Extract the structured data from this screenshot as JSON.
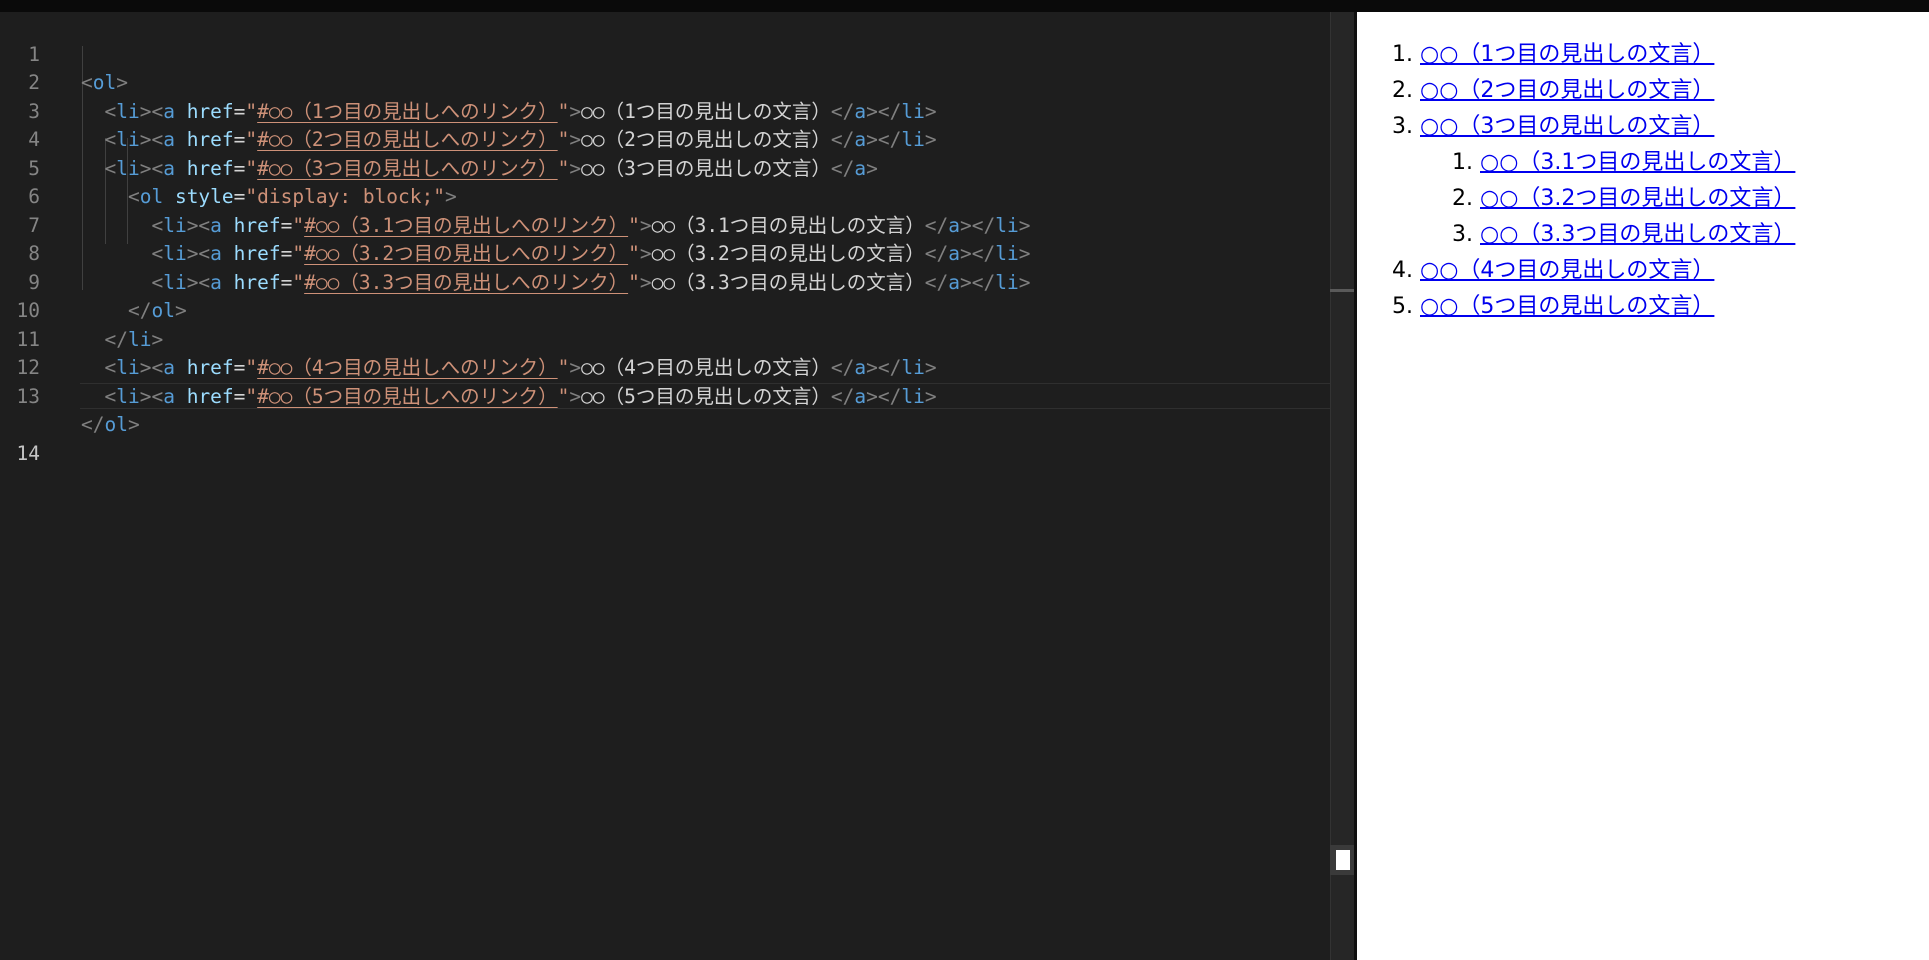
{
  "editor": {
    "lines": [
      {
        "num": "1",
        "open": "<ol>"
      },
      {
        "num": "2",
        "href": "#○○（1つ目の見出しへのリンク）",
        "text": "○○（1つ目の見出しの文言）"
      },
      {
        "num": "3",
        "href": "#○○（2つ目の見出しへのリンク）",
        "text": "○○（2つ目の見出しの文言）"
      },
      {
        "num": "4",
        "href": "#○○（3つ目の見出しへのリンク）",
        "text": "○○（3つ目の見出しの文言）"
      },
      {
        "num": "5",
        "style_value": "display: block;"
      },
      {
        "num": "6",
        "href": "#○○（3.1つ目の見出しへのリンク）",
        "text": "○○（3.1つ目の見出しの文言）"
      },
      {
        "num": "7",
        "href": "#○○（3.2つ目の見出しへのリンク）",
        "text": "○○（3.2つ目の見出しの文言）"
      },
      {
        "num": "8",
        "href": "#○○（3.3つ目の見出しへのリンク）",
        "text": "○○（3.3つ目の見出しの文言）"
      },
      {
        "num": "9",
        "close": "</ol>"
      },
      {
        "num": "10",
        "close": "</li>"
      },
      {
        "num": "11",
        "href": "#○○（4つ目の見出しへのリンク）",
        "text": "○○（4つ目の見出しの文言）"
      },
      {
        "num": "12",
        "href": "#○○（5つ目の見出しへのリンク）",
        "text": "○○（5つ目の見出しの文言）"
      },
      {
        "num": "13",
        "close": "</ol>"
      },
      {
        "num": "14"
      }
    ]
  },
  "preview": {
    "items": [
      {
        "num": "1.",
        "text": "○○（1つ目の見出しの文言）"
      },
      {
        "num": "2.",
        "text": "○○（2つ目の見出しの文言）"
      },
      {
        "num": "3.",
        "text": "○○（3つ目の見出しの文言）"
      },
      {
        "num": "1.",
        "text": "○○（3.1つ目の見出しの文言）"
      },
      {
        "num": "2.",
        "text": "○○（3.2つ目の見出しの文言）"
      },
      {
        "num": "3.",
        "text": "○○（3.3つ目の見出しの文言）"
      },
      {
        "num": "4.",
        "text": "○○（4つ目の見出しの文言）"
      },
      {
        "num": "5.",
        "text": "○○（5つ目の見出しの文言）"
      }
    ]
  },
  "colors": {
    "tag": "#569cd6",
    "attribute": "#9cdcfe",
    "string": "#ce9178",
    "punctuation": "#808080",
    "text": "#d4d4d4",
    "link": "#0000ee"
  }
}
